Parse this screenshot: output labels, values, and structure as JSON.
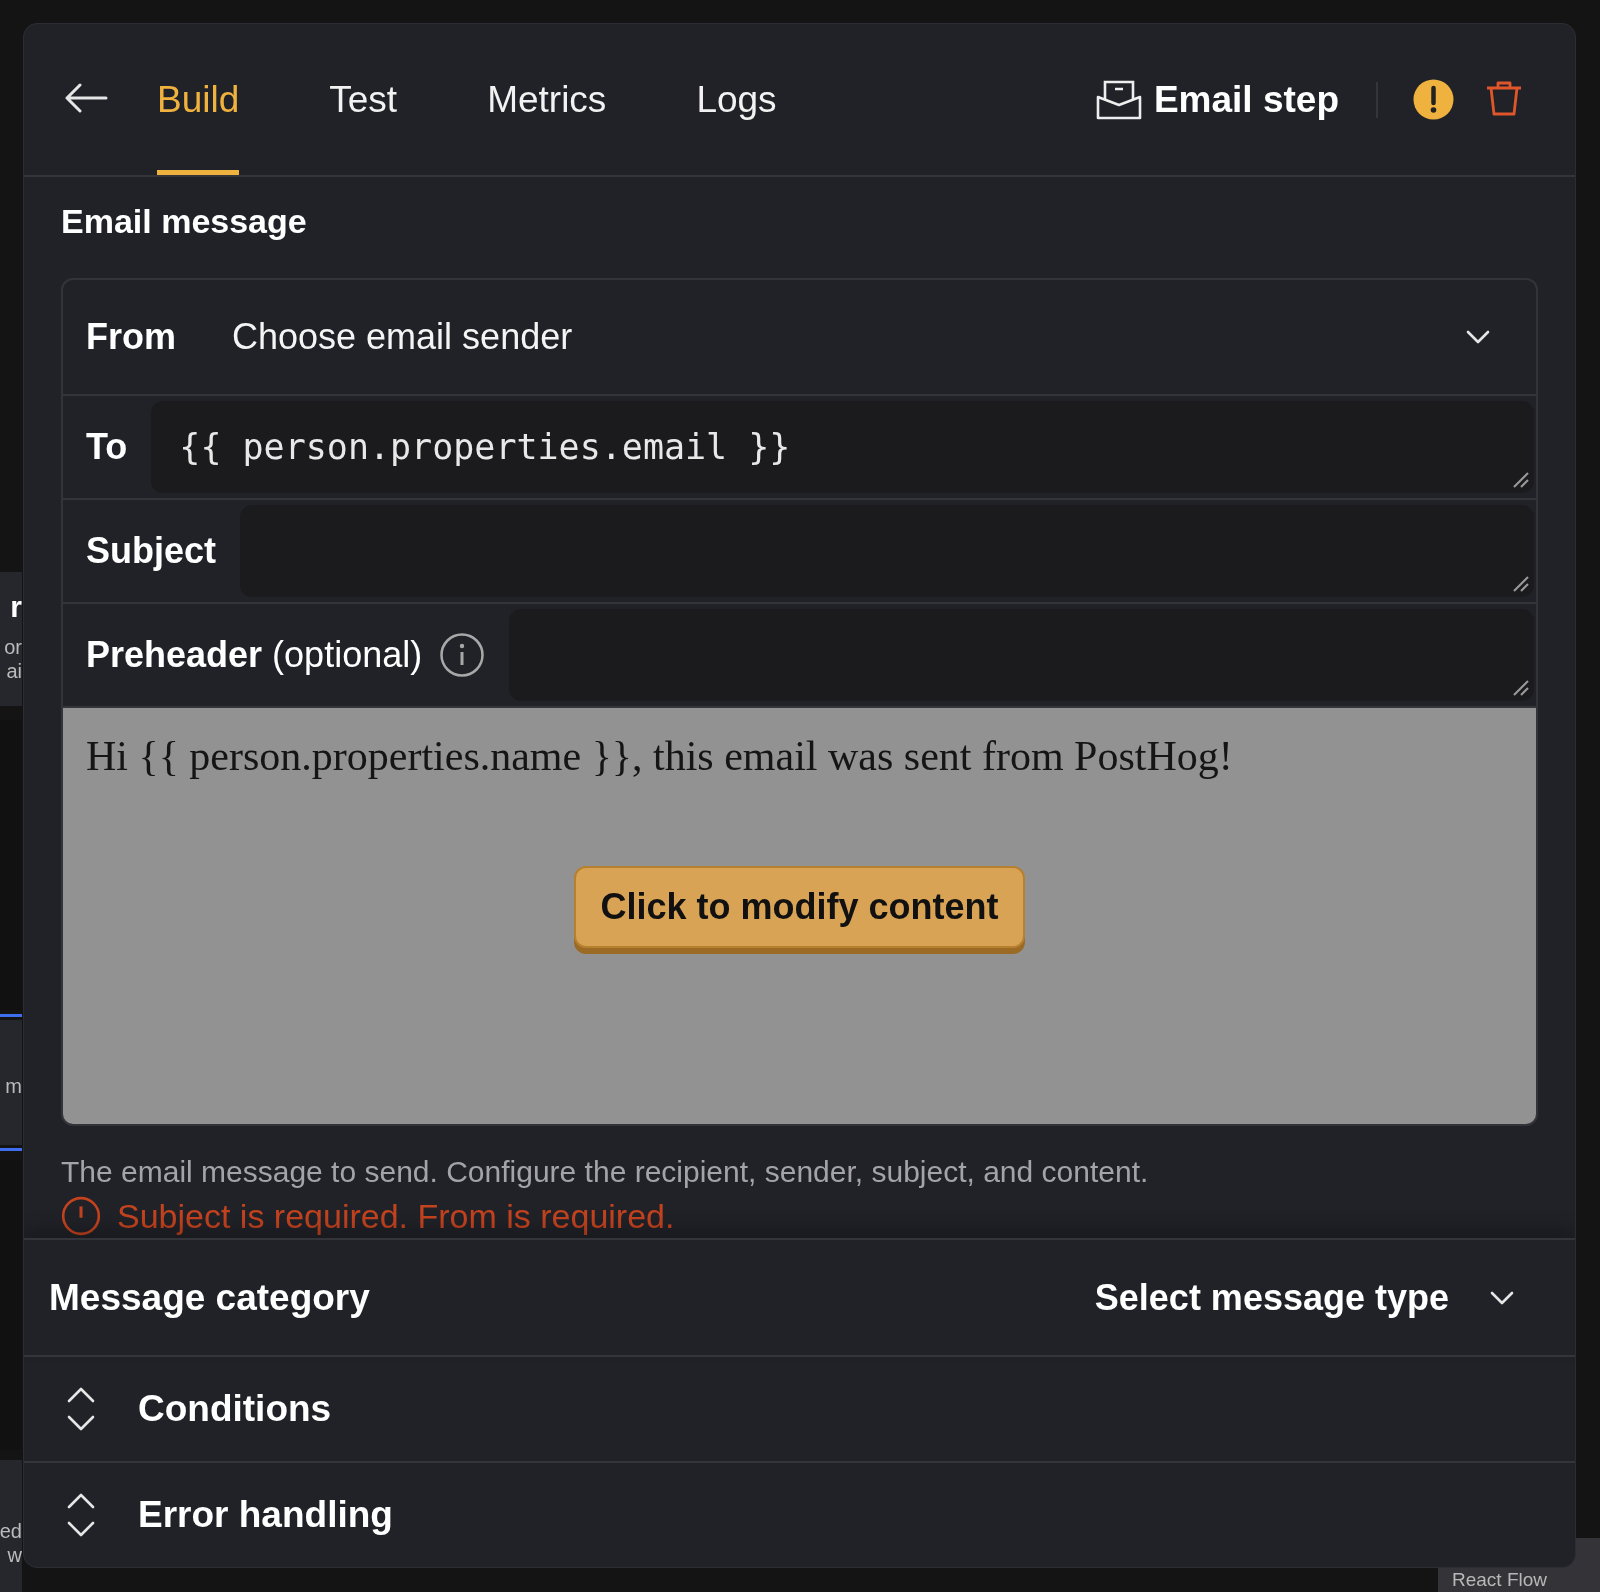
{
  "background": {
    "fragments": [
      {
        "text": "r",
        "bold": true
      },
      {
        "text": "or",
        "bold": false
      },
      {
        "text": "ai",
        "bold": false
      },
      {
        "text": "m",
        "bold": false
      },
      {
        "text": "ed",
        "bold": false
      },
      {
        "text": "w",
        "bold": false
      }
    ],
    "attribution": "React Flow"
  },
  "header": {
    "tabs": [
      {
        "label": "Build",
        "selected": true
      },
      {
        "label": "Test",
        "selected": false
      },
      {
        "label": "Metrics",
        "selected": false
      },
      {
        "label": "Logs",
        "selected": false
      }
    ],
    "step_title": "Email step",
    "warning": true
  },
  "section_title": "Email message",
  "from": {
    "label": "From",
    "placeholder": "Choose email sender"
  },
  "fields": [
    {
      "label": "To",
      "value": "{{ person.properties.email }}",
      "mono": true,
      "info": false
    },
    {
      "label": "Subject",
      "info": false
    },
    {
      "label": "**Preheader** (optional)",
      "info": true
    }
  ],
  "preview": {
    "text": "Hi {{ person.properties.name }}, this email was sent from PostHog!",
    "button": "Click to modify content"
  },
  "help_text": "The email message to send. Configure the recipient, sender, subject, and content.",
  "error": "Subject is required. From is required.",
  "message_category": {
    "label": "Message category",
    "placeholder": "Select message type"
  },
  "sections": [
    {
      "label": "Conditions"
    },
    {
      "label": "Error handling"
    }
  ]
}
